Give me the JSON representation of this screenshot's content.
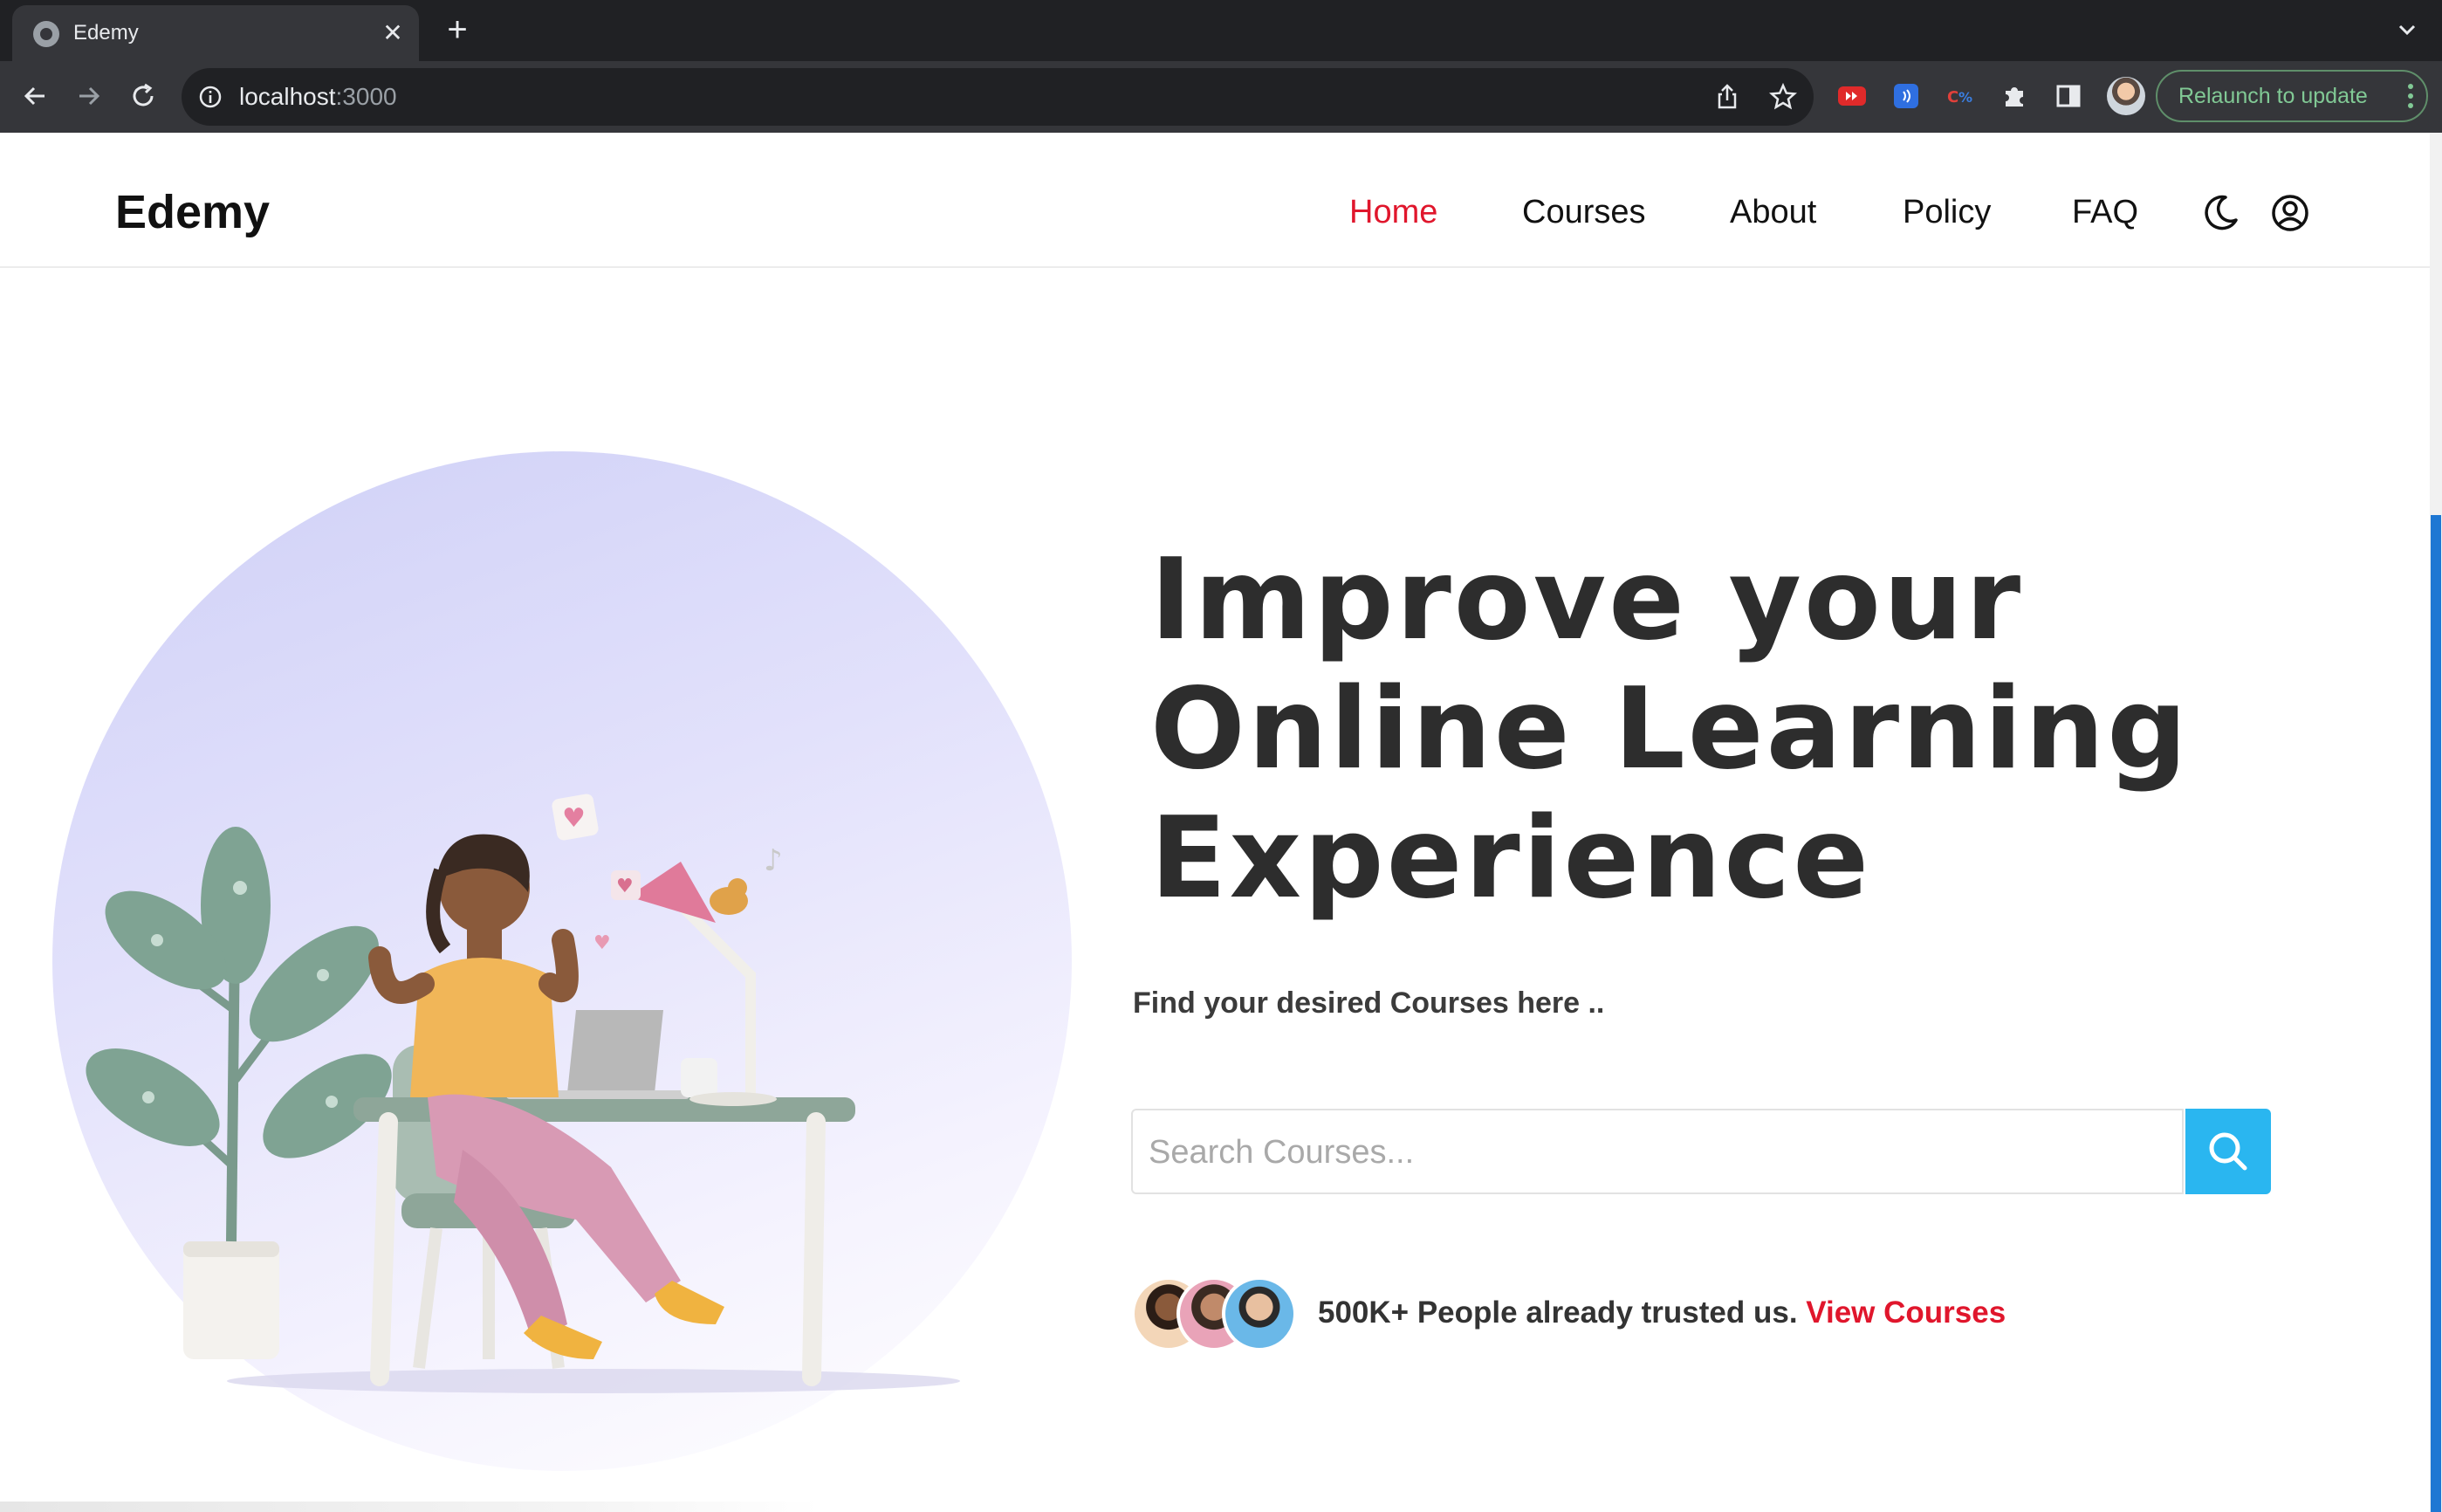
{
  "browser": {
    "tab_title": "Edemy",
    "url_host": "localhost",
    "url_port": ":3000",
    "relaunch_label": "Relaunch to update"
  },
  "site": {
    "logo": "Edemy",
    "nav": [
      {
        "label": "Home",
        "active": true
      },
      {
        "label": "Courses",
        "active": false
      },
      {
        "label": "About",
        "active": false
      },
      {
        "label": "Policy",
        "active": false
      },
      {
        "label": "FAQ",
        "active": false
      }
    ]
  },
  "hero": {
    "headline_lines": [
      "Improve your",
      "Online Learning",
      "Experience"
    ],
    "subtitle": "Find your desired Courses here ..",
    "search_placeholder": "Search Courses...",
    "trust_text": "500K+ People already trusted us.",
    "trust_link": "View Courses"
  },
  "colors": {
    "accent_red": "#e0162c",
    "search_button": "#2ab6f0",
    "headline": "#2d2d2d"
  },
  "icons": {
    "theme_toggle": "moon-icon",
    "account": "user-circle-icon",
    "search": "search-icon"
  }
}
